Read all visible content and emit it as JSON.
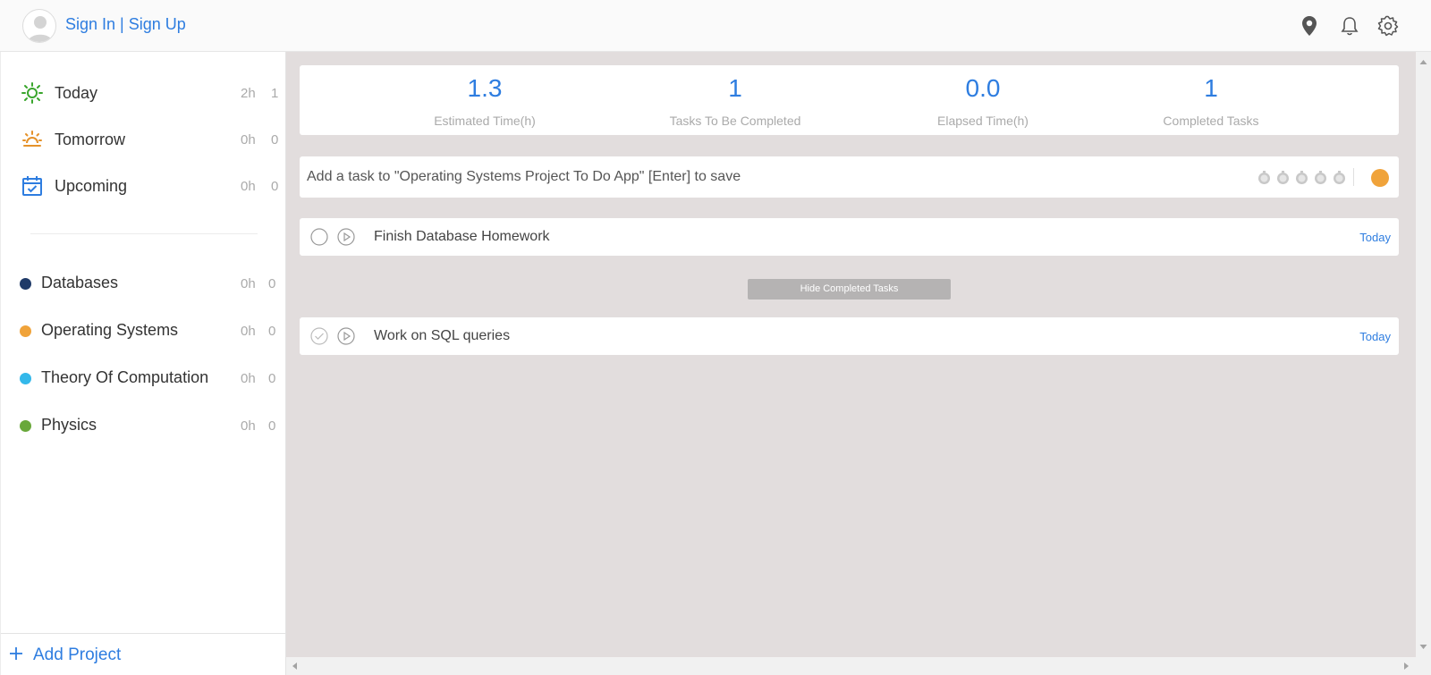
{
  "header": {
    "auth_label": "Sign In | Sign Up",
    "icons": [
      "location-pin-icon",
      "bell-icon",
      "gear-icon"
    ]
  },
  "sidebar": {
    "nav": [
      {
        "label": "Today",
        "hours": "2h",
        "count": "1",
        "icon": "sun-icon",
        "color": "#3aa62d"
      },
      {
        "label": "Tomorrow",
        "hours": "0h",
        "count": "0",
        "icon": "sunrise-icon",
        "color": "#e5922a"
      },
      {
        "label": "Upcoming",
        "hours": "0h",
        "count": "0",
        "icon": "calendar-check-icon",
        "color": "#2e7de0"
      }
    ],
    "projects": [
      {
        "label": "Databases",
        "hours": "0h",
        "count": "0",
        "color": "#1f3a68"
      },
      {
        "label": "Operating Systems",
        "hours": "0h",
        "count": "0",
        "color": "#f0a33a"
      },
      {
        "label": "Theory Of Computation",
        "hours": "0h",
        "count": "0",
        "color": "#33b8ea"
      },
      {
        "label": "Physics",
        "hours": "0h",
        "count": "0",
        "color": "#69a83a"
      }
    ],
    "add_project_label": "Add Project"
  },
  "stats": [
    {
      "value": "1.3",
      "caption": "Estimated Time(h)"
    },
    {
      "value": "1",
      "caption": "Tasks To Be Completed"
    },
    {
      "value": "0.0",
      "caption": "Elapsed Time(h)"
    },
    {
      "value": "1",
      "caption": "Completed Tasks"
    }
  ],
  "add_task": {
    "placeholder": "Add a task to \"Operating Systems Project To Do App\" [Enter] to save",
    "pomodoro_count": 5,
    "project_color": "#f0a33a"
  },
  "tasks": [
    {
      "title": "Finish Database Homework",
      "due": "Today",
      "completed": false
    },
    {
      "title": "Work on SQL queries",
      "due": "Today",
      "completed": true
    }
  ],
  "hide_completed_label": "Hide Completed Tasks",
  "colors": {
    "accent": "#2e7de0",
    "main_bg": "#e2dddd"
  }
}
